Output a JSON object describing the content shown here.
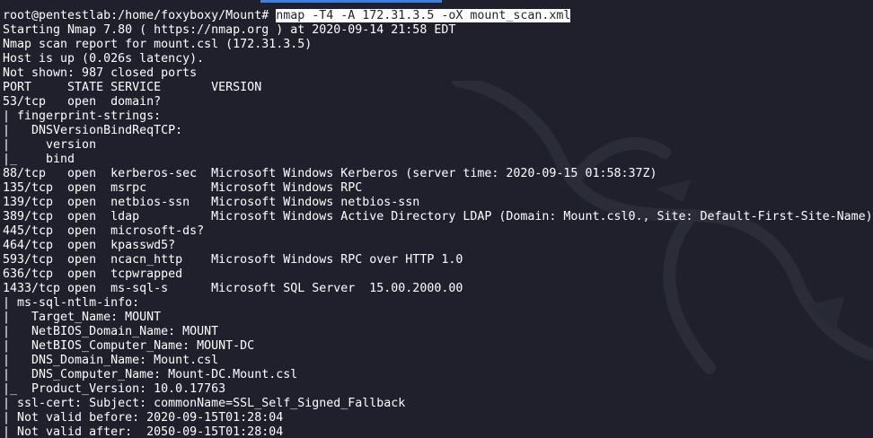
{
  "terminal": {
    "prompt": "root@pentestlab:/home/foxyboxy/Mount#",
    "command": "nmap -T4 -A 172.31.3.5 -oX mount_scan.xml",
    "output": [
      "Starting Nmap 7.80 ( https://nmap.org ) at 2020-09-14 21:58 EDT",
      "Nmap scan report for mount.csl (172.31.3.5)",
      "Host is up (0.026s latency).",
      "Not shown: 987 closed ports",
      "PORT     STATE SERVICE       VERSION",
      "53/tcp   open  domain?",
      "| fingerprint-strings:",
      "|   DNSVersionBindReqTCP:",
      "|     version",
      "|_    bind",
      "88/tcp   open  kerberos-sec  Microsoft Windows Kerberos (server time: 2020-09-15 01:58:37Z)",
      "135/tcp  open  msrpc         Microsoft Windows RPC",
      "139/tcp  open  netbios-ssn   Microsoft Windows netbios-ssn",
      "389/tcp  open  ldap          Microsoft Windows Active Directory LDAP (Domain: Mount.csl0., Site: Default-First-Site-Name)",
      "445/tcp  open  microsoft-ds?",
      "464/tcp  open  kpasswd5?",
      "593/tcp  open  ncacn_http    Microsoft Windows RPC over HTTP 1.0",
      "636/tcp  open  tcpwrapped",
      "1433/tcp open  ms-sql-s      Microsoft SQL Server  15.00.2000.00",
      "| ms-sql-ntlm-info:",
      "|   Target_Name: MOUNT",
      "|   NetBIOS_Domain_Name: MOUNT",
      "|   NetBIOS_Computer_Name: MOUNT-DC",
      "|   DNS_Domain_Name: Mount.csl",
      "|   DNS_Computer_Name: Mount-DC.Mount.csl",
      "|_  Product_Version: 10.0.17763",
      "| ssl-cert: Subject: commonName=SSL_Self_Signed_Fallback",
      "| Not valid before: 2020-09-15T01:28:04",
      "| Not valid after:  2050-09-15T01:28:04"
    ]
  },
  "colors": {
    "background": "#1f202b",
    "text": "#ffffff",
    "highlight_bg": "#ffffff",
    "highlight_fg": "#1f202b",
    "tab_accent": "#3f7fd8"
  },
  "icons": {
    "background_logo": "kali-dragon-icon"
  }
}
